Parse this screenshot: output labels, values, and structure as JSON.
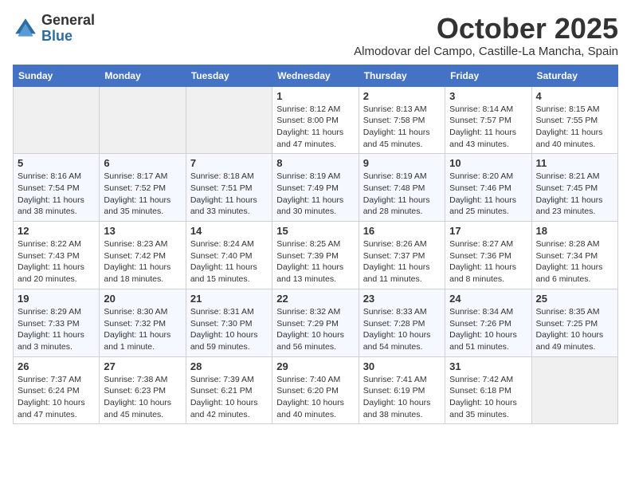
{
  "logo": {
    "general": "General",
    "blue": "Blue"
  },
  "title": "October 2025",
  "subtitle": "Almodovar del Campo, Castille-La Mancha, Spain",
  "days_of_week": [
    "Sunday",
    "Monday",
    "Tuesday",
    "Wednesday",
    "Thursday",
    "Friday",
    "Saturday"
  ],
  "weeks": [
    [
      {
        "day": "",
        "info": ""
      },
      {
        "day": "",
        "info": ""
      },
      {
        "day": "",
        "info": ""
      },
      {
        "day": "1",
        "info": "Sunrise: 8:12 AM\nSunset: 8:00 PM\nDaylight: 11 hours and 47 minutes."
      },
      {
        "day": "2",
        "info": "Sunrise: 8:13 AM\nSunset: 7:58 PM\nDaylight: 11 hours and 45 minutes."
      },
      {
        "day": "3",
        "info": "Sunrise: 8:14 AM\nSunset: 7:57 PM\nDaylight: 11 hours and 43 minutes."
      },
      {
        "day": "4",
        "info": "Sunrise: 8:15 AM\nSunset: 7:55 PM\nDaylight: 11 hours and 40 minutes."
      }
    ],
    [
      {
        "day": "5",
        "info": "Sunrise: 8:16 AM\nSunset: 7:54 PM\nDaylight: 11 hours and 38 minutes."
      },
      {
        "day": "6",
        "info": "Sunrise: 8:17 AM\nSunset: 7:52 PM\nDaylight: 11 hours and 35 minutes."
      },
      {
        "day": "7",
        "info": "Sunrise: 8:18 AM\nSunset: 7:51 PM\nDaylight: 11 hours and 33 minutes."
      },
      {
        "day": "8",
        "info": "Sunrise: 8:19 AM\nSunset: 7:49 PM\nDaylight: 11 hours and 30 minutes."
      },
      {
        "day": "9",
        "info": "Sunrise: 8:19 AM\nSunset: 7:48 PM\nDaylight: 11 hours and 28 minutes."
      },
      {
        "day": "10",
        "info": "Sunrise: 8:20 AM\nSunset: 7:46 PM\nDaylight: 11 hours and 25 minutes."
      },
      {
        "day": "11",
        "info": "Sunrise: 8:21 AM\nSunset: 7:45 PM\nDaylight: 11 hours and 23 minutes."
      }
    ],
    [
      {
        "day": "12",
        "info": "Sunrise: 8:22 AM\nSunset: 7:43 PM\nDaylight: 11 hours and 20 minutes."
      },
      {
        "day": "13",
        "info": "Sunrise: 8:23 AM\nSunset: 7:42 PM\nDaylight: 11 hours and 18 minutes."
      },
      {
        "day": "14",
        "info": "Sunrise: 8:24 AM\nSunset: 7:40 PM\nDaylight: 11 hours and 15 minutes."
      },
      {
        "day": "15",
        "info": "Sunrise: 8:25 AM\nSunset: 7:39 PM\nDaylight: 11 hours and 13 minutes."
      },
      {
        "day": "16",
        "info": "Sunrise: 8:26 AM\nSunset: 7:37 PM\nDaylight: 11 hours and 11 minutes."
      },
      {
        "day": "17",
        "info": "Sunrise: 8:27 AM\nSunset: 7:36 PM\nDaylight: 11 hours and 8 minutes."
      },
      {
        "day": "18",
        "info": "Sunrise: 8:28 AM\nSunset: 7:34 PM\nDaylight: 11 hours and 6 minutes."
      }
    ],
    [
      {
        "day": "19",
        "info": "Sunrise: 8:29 AM\nSunset: 7:33 PM\nDaylight: 11 hours and 3 minutes."
      },
      {
        "day": "20",
        "info": "Sunrise: 8:30 AM\nSunset: 7:32 PM\nDaylight: 11 hours and 1 minute."
      },
      {
        "day": "21",
        "info": "Sunrise: 8:31 AM\nSunset: 7:30 PM\nDaylight: 10 hours and 59 minutes."
      },
      {
        "day": "22",
        "info": "Sunrise: 8:32 AM\nSunset: 7:29 PM\nDaylight: 10 hours and 56 minutes."
      },
      {
        "day": "23",
        "info": "Sunrise: 8:33 AM\nSunset: 7:28 PM\nDaylight: 10 hours and 54 minutes."
      },
      {
        "day": "24",
        "info": "Sunrise: 8:34 AM\nSunset: 7:26 PM\nDaylight: 10 hours and 51 minutes."
      },
      {
        "day": "25",
        "info": "Sunrise: 8:35 AM\nSunset: 7:25 PM\nDaylight: 10 hours and 49 minutes."
      }
    ],
    [
      {
        "day": "26",
        "info": "Sunrise: 7:37 AM\nSunset: 6:24 PM\nDaylight: 10 hours and 47 minutes."
      },
      {
        "day": "27",
        "info": "Sunrise: 7:38 AM\nSunset: 6:23 PM\nDaylight: 10 hours and 45 minutes."
      },
      {
        "day": "28",
        "info": "Sunrise: 7:39 AM\nSunset: 6:21 PM\nDaylight: 10 hours and 42 minutes."
      },
      {
        "day": "29",
        "info": "Sunrise: 7:40 AM\nSunset: 6:20 PM\nDaylight: 10 hours and 40 minutes."
      },
      {
        "day": "30",
        "info": "Sunrise: 7:41 AM\nSunset: 6:19 PM\nDaylight: 10 hours and 38 minutes."
      },
      {
        "day": "31",
        "info": "Sunrise: 7:42 AM\nSunset: 6:18 PM\nDaylight: 10 hours and 35 minutes."
      },
      {
        "day": "",
        "info": ""
      }
    ]
  ]
}
